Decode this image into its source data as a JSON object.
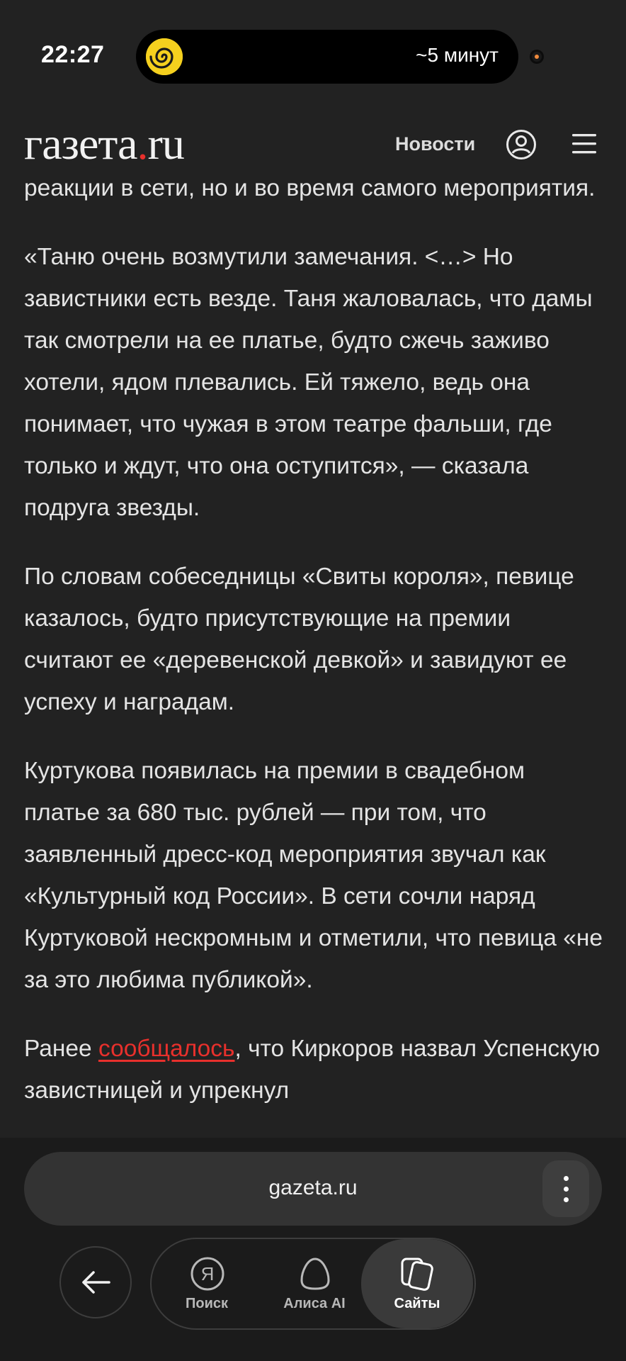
{
  "status_bar": {
    "time": "22:27",
    "island_text": "~5 минут",
    "island_logo_icon": "yandex-spiral-icon"
  },
  "header": {
    "logo_main": "газета",
    "logo_dot": ".",
    "logo_tail": "ru",
    "nav_news": "Новости",
    "icons": [
      "user-icon",
      "menu-icon"
    ]
  },
  "article": {
    "paragraphs": [
      "реакции в сети, но и во время самого мероприятия.",
      "«Таню очень возмутили замечания. <…> Но завистники есть везде. Таня жаловалась, что дамы так смотрели на ее платье, будто сжечь заживо хотели, ядом плевались. Ей тяжело, ведь она понимает, что чужая в этом театре фальши, где только и ждут, что она оступится», — сказала подруга звезды.",
      "По словам собеседницы «Свиты короля», певице казалось, будто присутствующие на премии считают ее «деревенской девкой» и завидуют ее успеху и наградам.",
      "Куртукова появилась на премии в свадебном платье за 680 тыс. рублей — при том, что заявленный дресс-код мероприятия звучал как «Культурный код России». В сети сочли наряд Куртуковой нескромным и отметили, что певица «не за это любима публикой»."
    ],
    "last_paragraph": {
      "before_link": "Ранее ",
      "link": "сообщалось",
      "after_link": ", что Киркоров назвал Успенскую завистницей и упрекнул"
    }
  },
  "browser": {
    "url": "gazeta.ru",
    "back_icon": "arrow-left-icon",
    "more_icon": "more-vertical-icon",
    "tabs": [
      {
        "label": "Поиск",
        "icon": "yandex-search-icon"
      },
      {
        "label": "Алиса AI",
        "icon": "alice-icon"
      },
      {
        "label": "Сайты",
        "icon": "tabs-icon"
      }
    ]
  },
  "colors": {
    "background": "#222222",
    "accent": "#e8302c",
    "text": "#e4e4e4"
  }
}
